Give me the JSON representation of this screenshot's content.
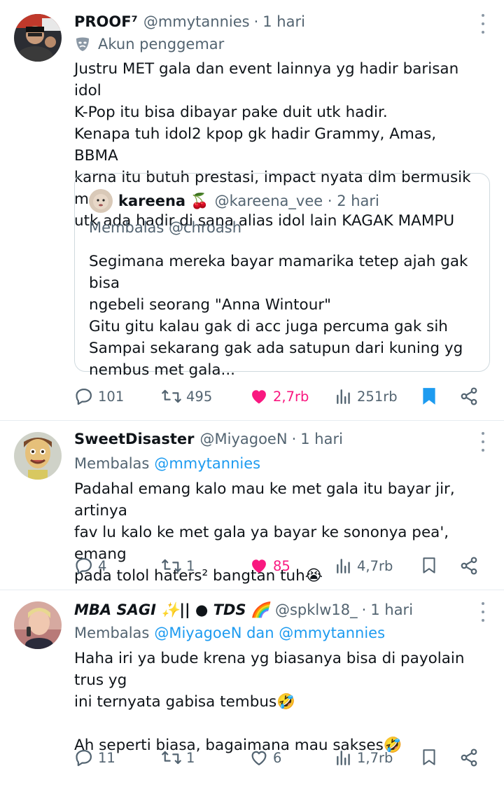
{
  "colors": {
    "accent": "#1d9bf0",
    "like": "#f91880",
    "muted": "#536471"
  },
  "tweets": [
    {
      "name": "PROOF⁷",
      "handle": "@mmytannies",
      "dot": "·",
      "time": "1 hari",
      "fan_label": "Akun penggemar",
      "text": "Justru MET gala dan event lainnya yg hadir barisan idol\nK-Pop itu bisa dibayar pake duit utk hadir.\nKenapa tuh idol2 kpop gk hadir Grammy, Amas, BBMA\nkarna itu butuh prestasi, impact nyata dlm bermusik mrk\nutk ada hadir di sana alias idol lain KAGAK MAMPU",
      "quote": {
        "name": "kareena 🍒",
        "handle": "@kareena_vee · 2 hari",
        "reply": "Membalas @chroash",
        "text": "Segimana mereka bayar mamarika tetep ajah gak bisa\nngebeli seorang \"Anna Wintour\"\nGitu gitu kalau gak di acc juga percuma gak sih\nSampai sekarang gak ada satupun dari kuning yg\nnembus met gala..."
      },
      "stats": {
        "replies": "101",
        "retweets": "495",
        "likes": "2,7rb",
        "views": "251rb"
      }
    },
    {
      "name": "SweetDisaster",
      "handle": "@MiyagoeN",
      "dot": "·",
      "time": "1 hari",
      "reply_prefix": "Membalas",
      "reply_to": "@mmytannies",
      "text": "Padahal emang kalo mau ke met gala itu bayar jir, artinya\nfav lu kalo ke met gala ya bayar ke sononya pea', emang\npada tolol haters² bangtan tuh😭",
      "stats": {
        "replies": "4",
        "retweets": "1",
        "likes": "85",
        "views": "4,7rb"
      }
    },
    {
      "name": "MBA SAGI ✨|| ● TDS 🌈",
      "handle": "@spklw18_",
      "dot": "·",
      "time": "1 hari",
      "reply_prefix": "Membalas",
      "reply_to": "@MiyagoeN dan @mmytannies",
      "text": "Haha iri ya bude krena yg biasanya bisa di payolain trus yg\nini ternyata gabisa tembus🤣\n\nAh seperti biasa, bagaimana mau sakses🤣",
      "stats": {
        "replies": "11",
        "retweets": "1",
        "likes": "6",
        "views": "1,7rb"
      }
    }
  ]
}
